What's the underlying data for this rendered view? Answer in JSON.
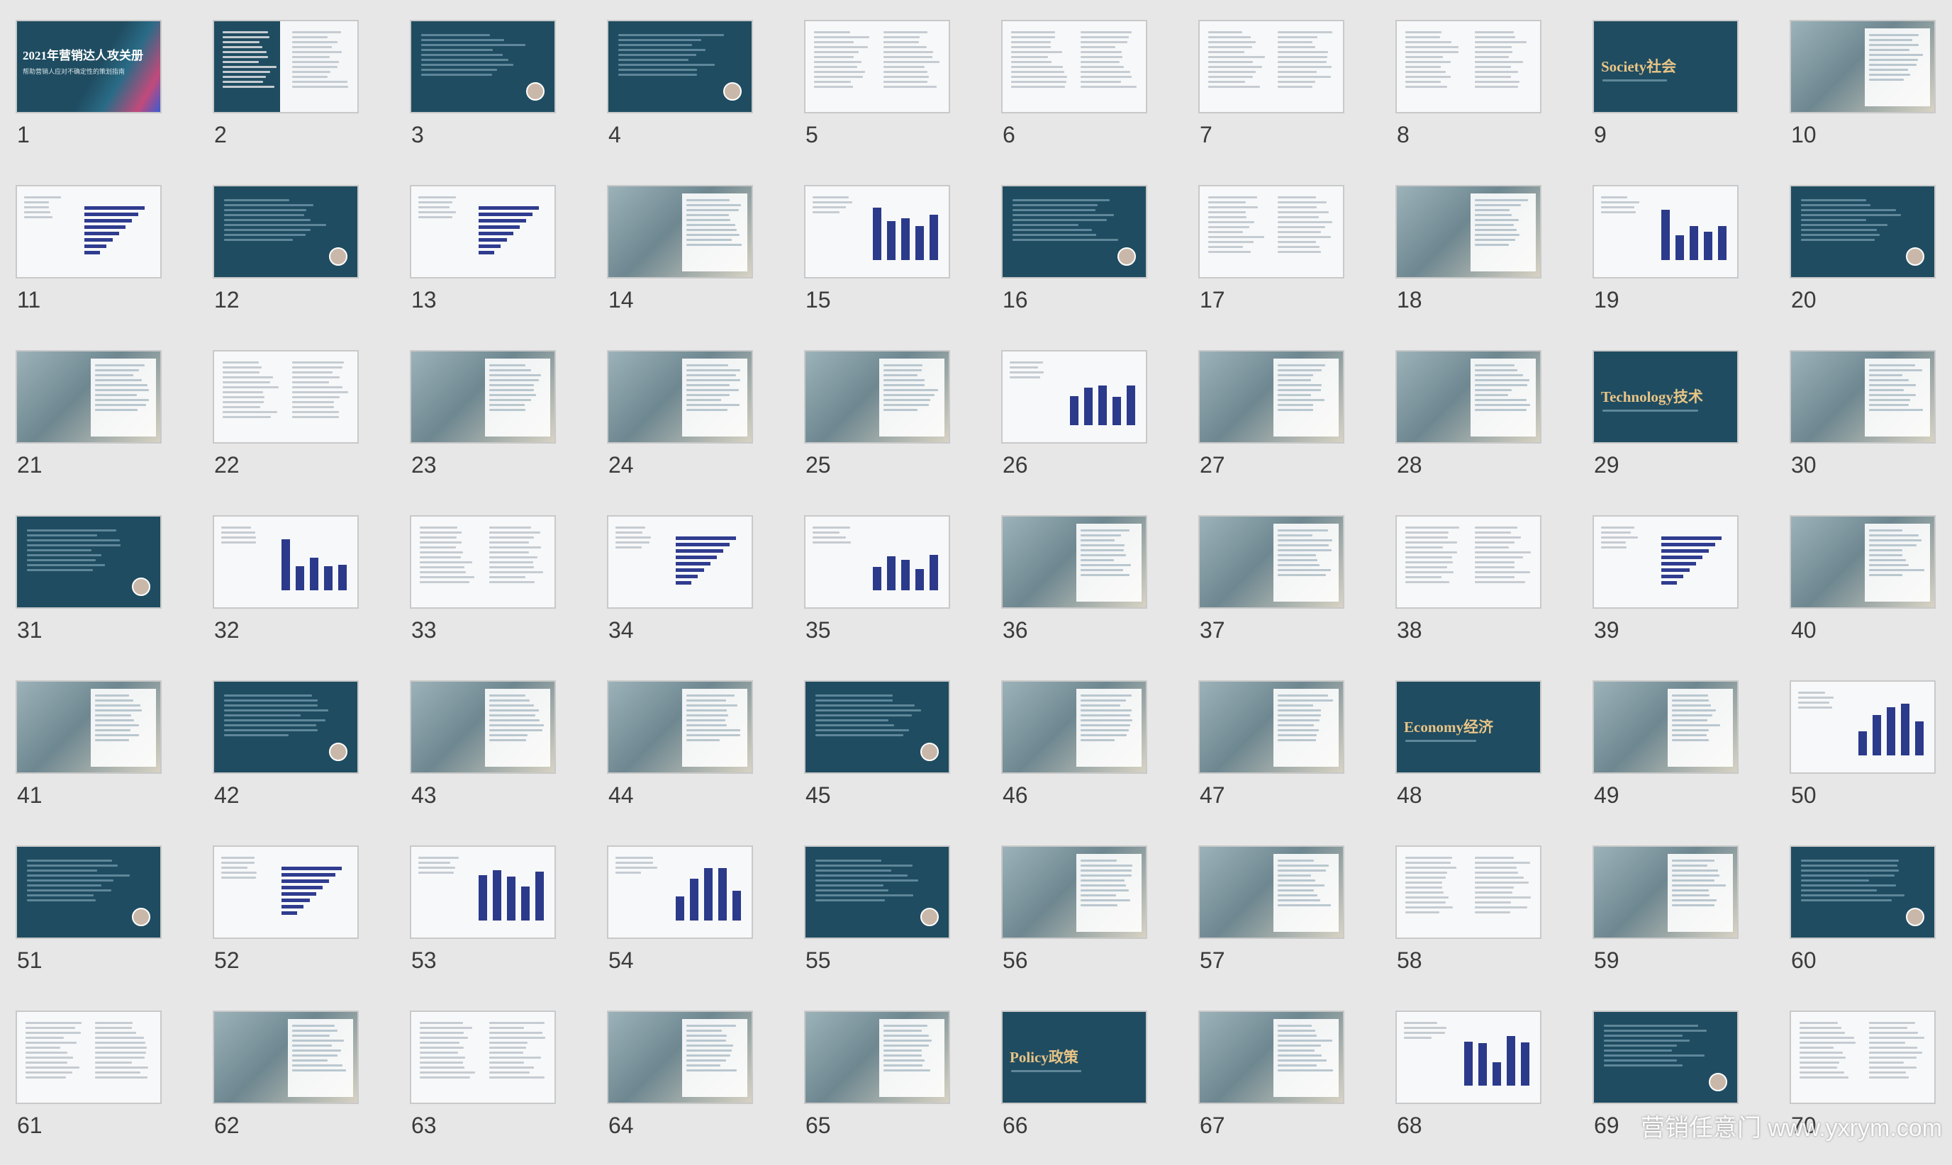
{
  "slides": [
    {
      "n": "1",
      "kind": "cover",
      "title": "2021年营销达人攻关册",
      "subtitle": "帮助营销人应对不确定性的策划指南"
    },
    {
      "n": "2",
      "kind": "mixed"
    },
    {
      "n": "3",
      "kind": "dark"
    },
    {
      "n": "4",
      "kind": "dark"
    },
    {
      "n": "5",
      "kind": "light"
    },
    {
      "n": "6",
      "kind": "light"
    },
    {
      "n": "7",
      "kind": "light"
    },
    {
      "n": "8",
      "kind": "light"
    },
    {
      "n": "9",
      "kind": "section",
      "title": "Society社会"
    },
    {
      "n": "10",
      "kind": "photo"
    },
    {
      "n": "11",
      "kind": "hbars"
    },
    {
      "n": "12",
      "kind": "dark"
    },
    {
      "n": "13",
      "kind": "hbars"
    },
    {
      "n": "14",
      "kind": "photo"
    },
    {
      "n": "15",
      "kind": "bars"
    },
    {
      "n": "16",
      "kind": "dark"
    },
    {
      "n": "17",
      "kind": "light"
    },
    {
      "n": "18",
      "kind": "photo"
    },
    {
      "n": "19",
      "kind": "bars"
    },
    {
      "n": "20",
      "kind": "dark"
    },
    {
      "n": "21",
      "kind": "photo"
    },
    {
      "n": "22",
      "kind": "light"
    },
    {
      "n": "23",
      "kind": "photo"
    },
    {
      "n": "24",
      "kind": "photo"
    },
    {
      "n": "25",
      "kind": "photo"
    },
    {
      "n": "26",
      "kind": "bars"
    },
    {
      "n": "27",
      "kind": "photo"
    },
    {
      "n": "28",
      "kind": "photo"
    },
    {
      "n": "29",
      "kind": "section",
      "title": "Technology技术"
    },
    {
      "n": "30",
      "kind": "photo"
    },
    {
      "n": "31",
      "kind": "dark"
    },
    {
      "n": "32",
      "kind": "bars"
    },
    {
      "n": "33",
      "kind": "light"
    },
    {
      "n": "34",
      "kind": "hbars"
    },
    {
      "n": "35",
      "kind": "bars"
    },
    {
      "n": "36",
      "kind": "photo"
    },
    {
      "n": "37",
      "kind": "photo"
    },
    {
      "n": "38",
      "kind": "light"
    },
    {
      "n": "39",
      "kind": "hbars"
    },
    {
      "n": "40",
      "kind": "photo"
    },
    {
      "n": "41",
      "kind": "photo"
    },
    {
      "n": "42",
      "kind": "dark"
    },
    {
      "n": "43",
      "kind": "photo"
    },
    {
      "n": "44",
      "kind": "photo"
    },
    {
      "n": "45",
      "kind": "dark"
    },
    {
      "n": "46",
      "kind": "photo"
    },
    {
      "n": "47",
      "kind": "photo"
    },
    {
      "n": "48",
      "kind": "section",
      "title": "Economy经济"
    },
    {
      "n": "49",
      "kind": "photo"
    },
    {
      "n": "50",
      "kind": "bars"
    },
    {
      "n": "51",
      "kind": "dark"
    },
    {
      "n": "52",
      "kind": "hbars"
    },
    {
      "n": "53",
      "kind": "bars"
    },
    {
      "n": "54",
      "kind": "bars"
    },
    {
      "n": "55",
      "kind": "dark"
    },
    {
      "n": "56",
      "kind": "photo"
    },
    {
      "n": "57",
      "kind": "photo"
    },
    {
      "n": "58",
      "kind": "light"
    },
    {
      "n": "59",
      "kind": "photo"
    },
    {
      "n": "60",
      "kind": "dark"
    },
    {
      "n": "61",
      "kind": "light"
    },
    {
      "n": "62",
      "kind": "photo"
    },
    {
      "n": "63",
      "kind": "light"
    },
    {
      "n": "64",
      "kind": "photo"
    },
    {
      "n": "65",
      "kind": "photo"
    },
    {
      "n": "66",
      "kind": "section",
      "title": "Policy政策"
    },
    {
      "n": "67",
      "kind": "photo"
    },
    {
      "n": "68",
      "kind": "bars"
    },
    {
      "n": "69",
      "kind": "dark"
    },
    {
      "n": "70",
      "kind": "light"
    }
  ],
  "watermark": "营销任意门  www.yxrym.com",
  "colors": {
    "background": "#e7e7e7",
    "slide_dark": "#1f4c61",
    "section_title": "#e8c486",
    "chart_bar": "#2b3a8a",
    "number_text": "#3b3b3b"
  }
}
